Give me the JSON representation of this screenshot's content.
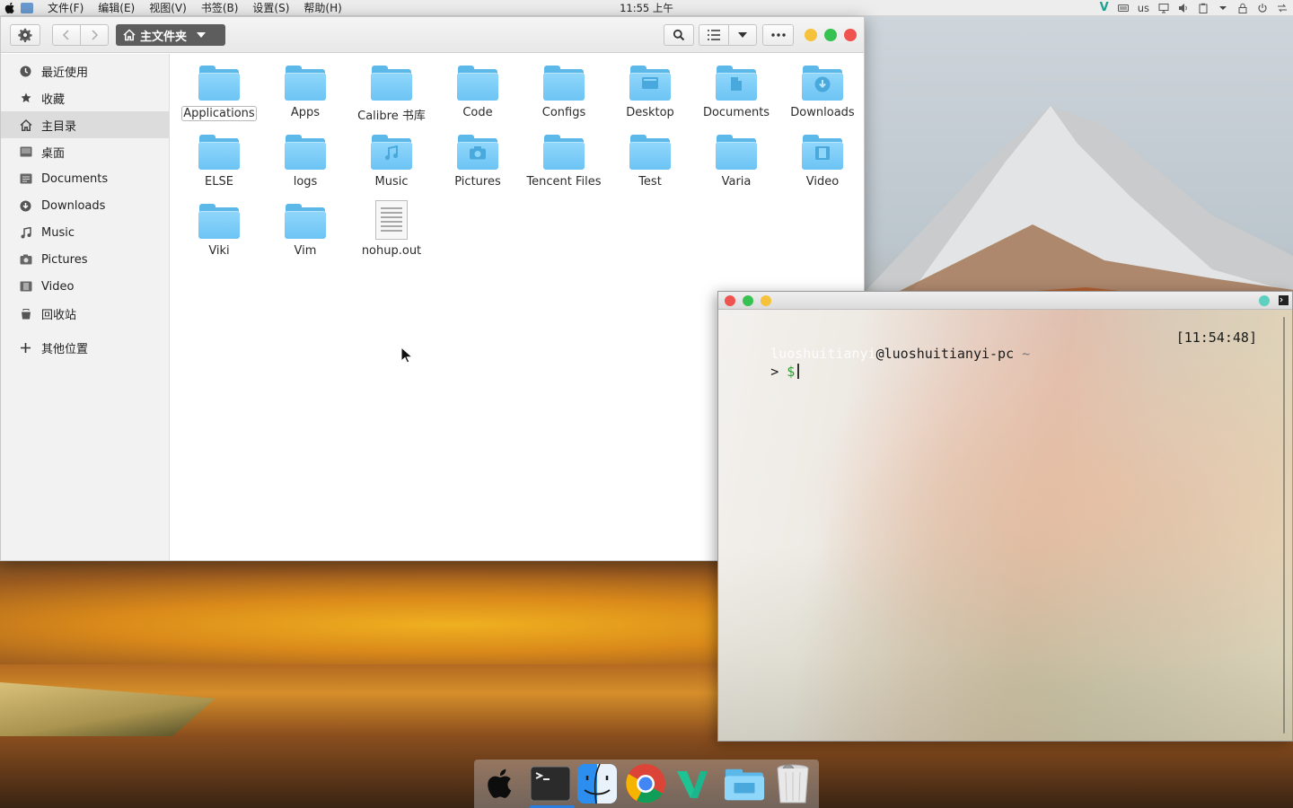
{
  "menubar": {
    "menus": [
      "文件(F)",
      "编辑(E)",
      "视图(V)",
      "书签(B)",
      "设置(S)",
      "帮助(H)"
    ],
    "clock": "11:55 上午",
    "tray_keyboard": "us",
    "tray_icons": [
      "vivaldi-icon",
      "keyboard-icon",
      "display-icon",
      "volume-icon",
      "clipboard-icon",
      "chevron-down-icon",
      "lock-icon",
      "power-icon",
      "network-icon"
    ]
  },
  "file_manager": {
    "path_label": "主文件夹",
    "sidebar": [
      {
        "label": "最近使用",
        "icon": "clock-icon"
      },
      {
        "label": "收藏",
        "icon": "star-icon"
      },
      {
        "label": "主目录",
        "icon": "home-icon",
        "active": true
      },
      {
        "label": "桌面",
        "icon": "desktop-icon"
      },
      {
        "label": "Documents",
        "icon": "document-icon"
      },
      {
        "label": "Downloads",
        "icon": "download-icon"
      },
      {
        "label": "Music",
        "icon": "music-icon"
      },
      {
        "label": "Pictures",
        "icon": "camera-icon"
      },
      {
        "label": "Video",
        "icon": "film-icon"
      },
      {
        "label": "回收站",
        "icon": "trash-icon"
      },
      {
        "label": "其他位置",
        "icon": "plus-icon"
      }
    ],
    "files": [
      {
        "name": "Applications",
        "type": "folder",
        "selected": true
      },
      {
        "name": "Apps",
        "type": "folder"
      },
      {
        "name": "Calibre 书库",
        "type": "folder"
      },
      {
        "name": "Code",
        "type": "folder"
      },
      {
        "name": "Configs",
        "type": "folder"
      },
      {
        "name": "Desktop",
        "type": "folder",
        "glyph": "desktop"
      },
      {
        "name": "Documents",
        "type": "folder",
        "glyph": "document"
      },
      {
        "name": "Downloads",
        "type": "folder",
        "glyph": "download"
      },
      {
        "name": "ELSE",
        "type": "folder"
      },
      {
        "name": "logs",
        "type": "folder"
      },
      {
        "name": "Music",
        "type": "folder",
        "glyph": "music"
      },
      {
        "name": "Pictures",
        "type": "folder",
        "glyph": "camera"
      },
      {
        "name": "Tencent Files",
        "type": "folder"
      },
      {
        "name": "Test",
        "type": "folder"
      },
      {
        "name": "Varia",
        "type": "folder"
      },
      {
        "name": "Video",
        "type": "folder",
        "glyph": "film"
      },
      {
        "name": "Viki",
        "type": "folder"
      },
      {
        "name": "Vim",
        "type": "folder"
      },
      {
        "name": "nohup.out",
        "type": "text"
      }
    ]
  },
  "terminal": {
    "user": "luoshuitianyi",
    "host": "@luoshuitianyi-pc",
    "cwd": "~",
    "time": "[11:54:48]",
    "prompt_arrow": ">",
    "prompt_symbol": "$"
  },
  "dock": {
    "items": [
      "apple-icon",
      "terminal-icon",
      "finder-icon",
      "chrome-icon",
      "vivaldi-icon",
      "folder-icon",
      "trash-icon"
    ]
  },
  "colors": {
    "folder": "#6cc4f4",
    "close": "#ff5f57",
    "minimize": "#febc2e",
    "maximize": "#28c840",
    "path_button": "#5d5d5d"
  }
}
